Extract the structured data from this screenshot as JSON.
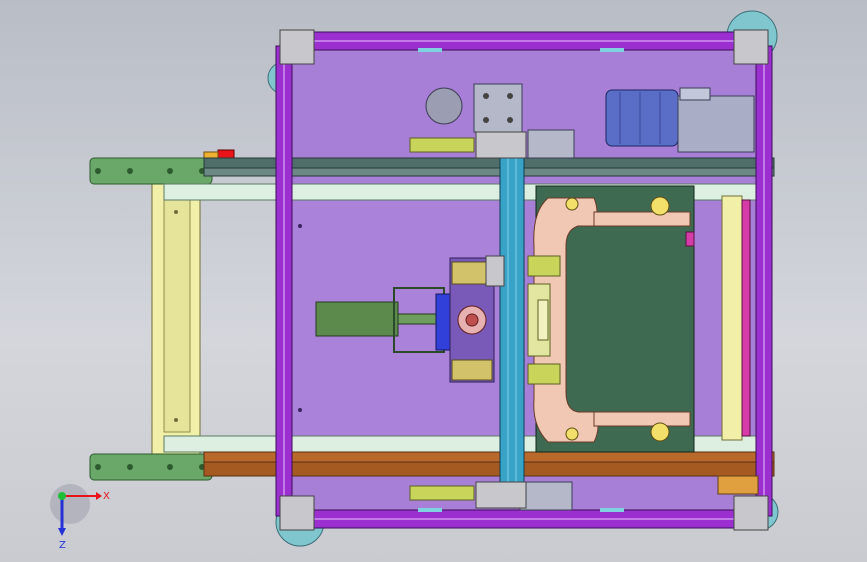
{
  "triad": {
    "x_label": "X",
    "y_label": "Y",
    "z_label": "Z",
    "x_color": "#e8141a",
    "y_color": "#1fbf3a",
    "z_color": "#2430d8"
  },
  "colors": {
    "background": "#c8cad0",
    "frame_profile": "#9b2fd0",
    "base_plate": "#a87fd6",
    "rail": "#4f6e6a",
    "rail_bottom": "#b9692b",
    "guide": "#f2f0a8",
    "bracket": "#6aa86a",
    "motor": "#5a6ec8",
    "cylinder": "#5c8a4c",
    "fixture": "#f0c8b4",
    "fixture_base": "#3f6a52",
    "beam": "#38a3c6",
    "caster": "#7fc6cf"
  },
  "icons": [
    "coordinate-triad-icon"
  ]
}
